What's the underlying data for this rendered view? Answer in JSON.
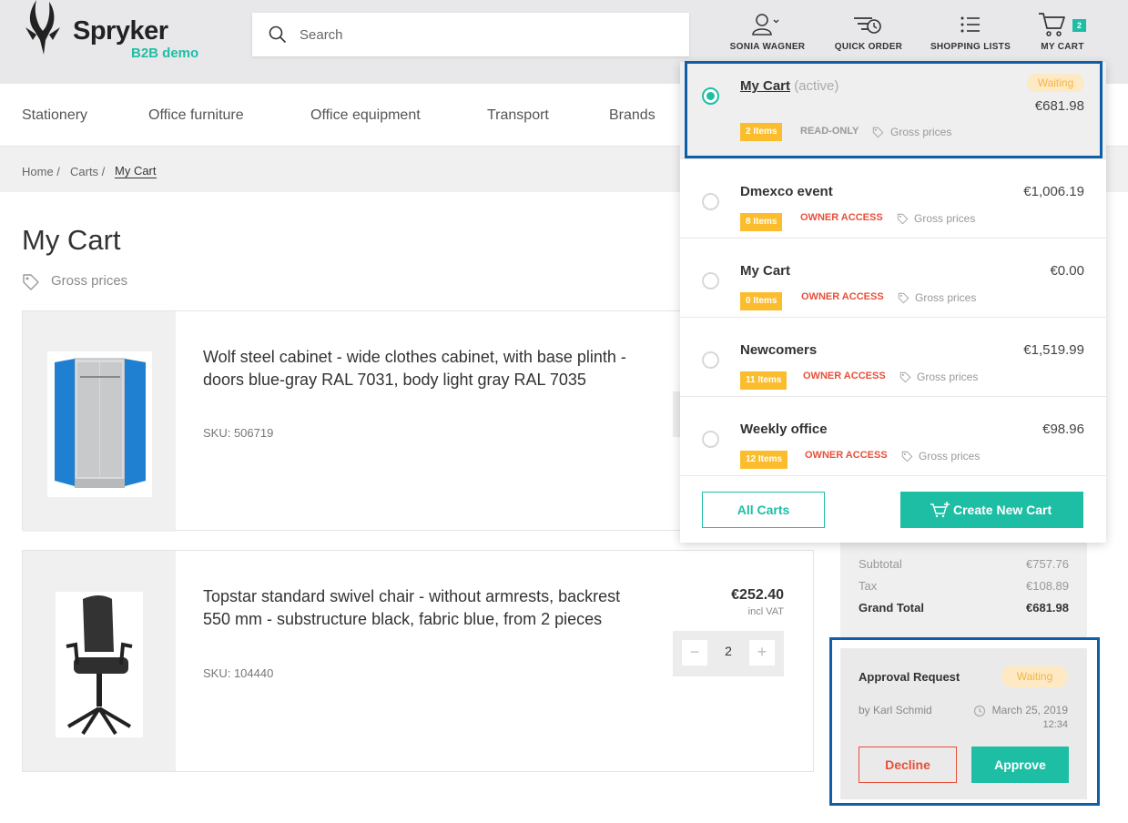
{
  "brand": {
    "name": "Spryker",
    "sub": "B2B demo"
  },
  "search": {
    "placeholder": "Search"
  },
  "tools": {
    "user": "SONIA WAGNER",
    "quick_order": "QUICK ORDER",
    "shopping_lists": "SHOPPING LISTS",
    "my_cart": "MY CART",
    "cart_count": "2"
  },
  "categories": [
    "Stationery",
    "Office furniture",
    "Office equipment",
    "Transport",
    "Brands"
  ],
  "breadcrumb": {
    "home": "Home /",
    "carts": "Carts /",
    "current": "My Cart"
  },
  "page": {
    "title": "My Cart",
    "gross_prices": "Gross prices"
  },
  "items": [
    {
      "name": "Wolf steel cabinet - wide clothes cabinet, with base plinth - doors blue-gray RAL 7031, body light gray RAL 7035",
      "sku": "SKU: 506719"
    },
    {
      "name": "Topstar standard swivel chair - without armrests, backrest 550 mm - substructure black, fabric blue, from 2 pieces",
      "sku": "SKU: 104440",
      "price": "€252.40",
      "vat": "incl VAT",
      "qty": "2"
    }
  ],
  "summary": {
    "subtotal_label": "Subtotal",
    "subtotal": "€757.76",
    "tax_label": "Tax",
    "tax": "€108.89",
    "grand_label": "Grand Total",
    "grand": "€681.98"
  },
  "approval": {
    "title": "Approval Request",
    "status": "Waiting",
    "by": "by Karl Schmid",
    "date": "March 25, 2019",
    "time": "12:34",
    "decline": "Decline",
    "approve": "Approve"
  },
  "dropdown": {
    "active": {
      "name": "My Cart",
      "tag": "(active)",
      "status": "Waiting",
      "price": "€681.98",
      "items": "2 Items",
      "access": "READ-ONLY",
      "gross": "Gross prices"
    },
    "carts": [
      {
        "name": "Dmexco event",
        "price": "€1,006.19",
        "items": "8 Items",
        "access": "OWNER ACCESS",
        "gross": "Gross prices"
      },
      {
        "name": "My Cart",
        "price": "€0.00",
        "items": "0 Items",
        "access": "OWNER ACCESS",
        "gross": "Gross prices"
      },
      {
        "name": "Newcomers",
        "price": "€1,519.99",
        "items": "11 Items",
        "access": "OWNER ACCESS",
        "gross": "Gross prices"
      },
      {
        "name": "Weekly office",
        "price": "€98.96",
        "items": "12 Items",
        "access": "OWNER ACCESS",
        "gross": "Gross prices"
      }
    ],
    "all_carts": "All Carts",
    "create": "Create New Cart"
  },
  "colors": {
    "accent": "#1ebea5",
    "badge": "#fbbd2e",
    "access": "#e8503a",
    "highlight": "#0f5fa8"
  }
}
